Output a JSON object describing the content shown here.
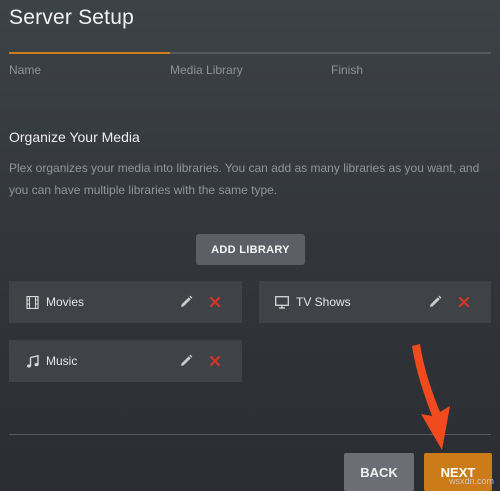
{
  "header": {
    "title": "Server Setup",
    "steps": [
      "Name",
      "Media Library",
      "Finish"
    ]
  },
  "section": {
    "title": "Organize Your Media",
    "description": "Plex organizes your media into libraries. You can add as many libraries as you want, and you can have multiple libraries with the same type."
  },
  "add_library_label": "ADD LIBRARY",
  "libraries": [
    {
      "label": "Movies",
      "icon": "film-icon"
    },
    {
      "label": "TV Shows",
      "icon": "tv-icon"
    },
    {
      "label": "Music",
      "icon": "music-note-icon"
    }
  ],
  "footer": {
    "back_label": "BACK",
    "next_label": "NEXT"
  },
  "watermark": "wsxdn.com",
  "colors": {
    "accent": "#cc7b19",
    "delete": "#d0352a",
    "arrow": "#f04a1e"
  }
}
